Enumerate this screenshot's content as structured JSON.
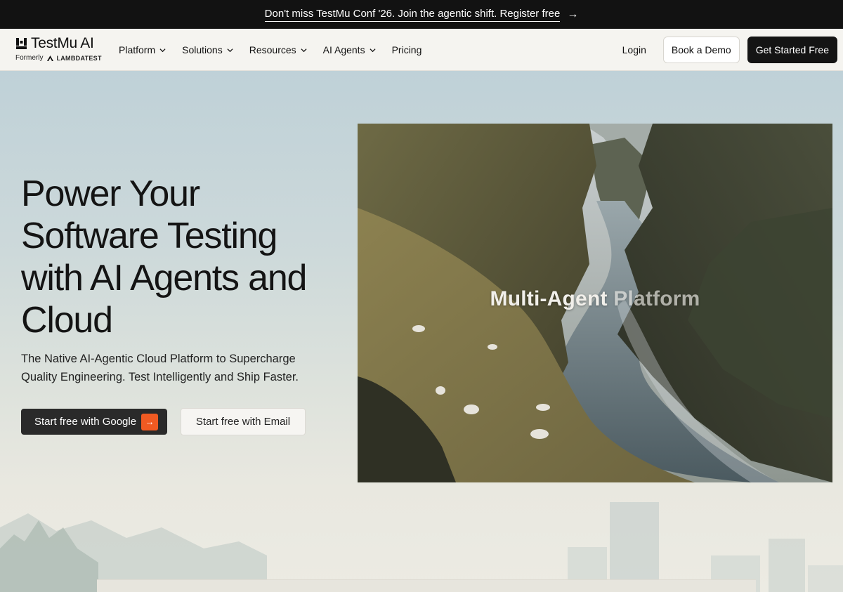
{
  "announcement": {
    "text": "Don't miss TestMu Conf '26. Join the agentic shift. Register free",
    "arrow_icon": "arrow-right-icon"
  },
  "brand": {
    "name": "TestMu AI",
    "formerly_label": "Formerly",
    "formerly_brand": "LAMBDATEST"
  },
  "nav": {
    "items": [
      {
        "label": "Platform",
        "has_dropdown": true
      },
      {
        "label": "Solutions",
        "has_dropdown": true
      },
      {
        "label": "Resources",
        "has_dropdown": true
      },
      {
        "label": "AI Agents",
        "has_dropdown": true
      },
      {
        "label": "Pricing",
        "has_dropdown": false
      }
    ],
    "login": "Login",
    "book_demo": "Book a Demo",
    "get_started": "Get Started Free"
  },
  "hero": {
    "title_lines": [
      "Power Your",
      "Software Testing",
      "with AI Agents and",
      "Cloud"
    ],
    "subtitle": "The Native AI-Agentic Cloud Platform to Supercharge Quality Engineering. Test Intelligently and Ship Faster.",
    "google_button": "Start free with Google",
    "email_button": "Start free with Email",
    "visual_label_main": "Multi-Agent ",
    "visual_label_fade": "Platform"
  },
  "colors": {
    "accent": "#f05a22",
    "dark": "#141414",
    "announcement_bg": "#121212"
  }
}
